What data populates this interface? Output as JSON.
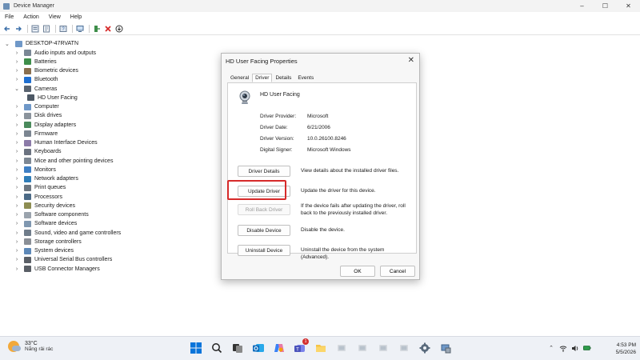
{
  "window": {
    "title": "Device Manager"
  },
  "menu": [
    "File",
    "Action",
    "View",
    "Help"
  ],
  "tree": {
    "root": "DESKTOP-47RVATN",
    "items": [
      {
        "label": "Audio inputs and outputs",
        "icon": "speaker-icon",
        "expanded": false
      },
      {
        "label": "Batteries",
        "icon": "battery-icon",
        "expanded": false
      },
      {
        "label": "Biometric devices",
        "icon": "fingerprint-icon",
        "expanded": false
      },
      {
        "label": "Bluetooth",
        "icon": "bluetooth-icon",
        "expanded": false
      },
      {
        "label": "Cameras",
        "icon": "camera-icon",
        "expanded": true
      },
      {
        "label": "HD User Facing",
        "icon": "webcam-icon",
        "child": true
      },
      {
        "label": "Computer",
        "icon": "computer-icon",
        "expanded": false
      },
      {
        "label": "Disk drives",
        "icon": "disk-icon",
        "expanded": false
      },
      {
        "label": "Display adapters",
        "icon": "display-adapter-icon",
        "expanded": false
      },
      {
        "label": "Firmware",
        "icon": "firmware-icon",
        "expanded": false
      },
      {
        "label": "Human Interface Devices",
        "icon": "hid-icon",
        "expanded": false
      },
      {
        "label": "Keyboards",
        "icon": "keyboard-icon",
        "expanded": false
      },
      {
        "label": "Mice and other pointing devices",
        "icon": "mouse-icon",
        "expanded": false
      },
      {
        "label": "Monitors",
        "icon": "monitor-icon",
        "expanded": false
      },
      {
        "label": "Network adapters",
        "icon": "network-icon",
        "expanded": false
      },
      {
        "label": "Print queues",
        "icon": "printer-icon",
        "expanded": false
      },
      {
        "label": "Processors",
        "icon": "processor-icon",
        "expanded": false
      },
      {
        "label": "Security devices",
        "icon": "security-icon",
        "expanded": false
      },
      {
        "label": "Software components",
        "icon": "software-component-icon",
        "expanded": false
      },
      {
        "label": "Software devices",
        "icon": "software-device-icon",
        "expanded": false
      },
      {
        "label": "Sound, video and game controllers",
        "icon": "sound-icon",
        "expanded": false
      },
      {
        "label": "Storage controllers",
        "icon": "storage-icon",
        "expanded": false
      },
      {
        "label": "System devices",
        "icon": "system-icon",
        "expanded": false
      },
      {
        "label": "Universal Serial Bus controllers",
        "icon": "usb-icon",
        "expanded": false
      },
      {
        "label": "USB Connector Managers",
        "icon": "usb-connector-icon",
        "expanded": false
      }
    ]
  },
  "dialog": {
    "title": "HD User Facing Properties",
    "tabs": [
      "General",
      "Driver",
      "Details",
      "Events"
    ],
    "active_tab": "Driver",
    "device_name": "HD User Facing",
    "properties": [
      {
        "label": "Driver Provider:",
        "value": "Microsoft"
      },
      {
        "label": "Driver Date:",
        "value": "6/21/2006"
      },
      {
        "label": "Driver Version:",
        "value": "10.0.26100.8246"
      },
      {
        "label": "Digital Signer:",
        "value": "Microsoft Windows"
      }
    ],
    "actions": [
      {
        "button": "Driver Details",
        "desc": "View details about the installed driver files."
      },
      {
        "button": "Update Driver",
        "desc": "Update the driver for this device."
      },
      {
        "button": "Roll Back Driver",
        "desc": "If the device fails after updating the driver, roll back to the previously installed driver."
      },
      {
        "button": "Disable Device",
        "desc": "Disable the device."
      },
      {
        "button": "Uninstall Device",
        "desc": "Uninstall the device from the system (Advanced)."
      }
    ],
    "ok": "OK",
    "cancel": "Cancel"
  },
  "taskbar": {
    "weather": {
      "temp": "33°C",
      "condition": "Nắng rải rác"
    },
    "chat_badge": "1",
    "clock": {
      "time": "4:53 PM",
      "date": "5/5/2026"
    }
  },
  "colors": {
    "highlight": "#d62a2a",
    "accent": "#0067c0"
  }
}
